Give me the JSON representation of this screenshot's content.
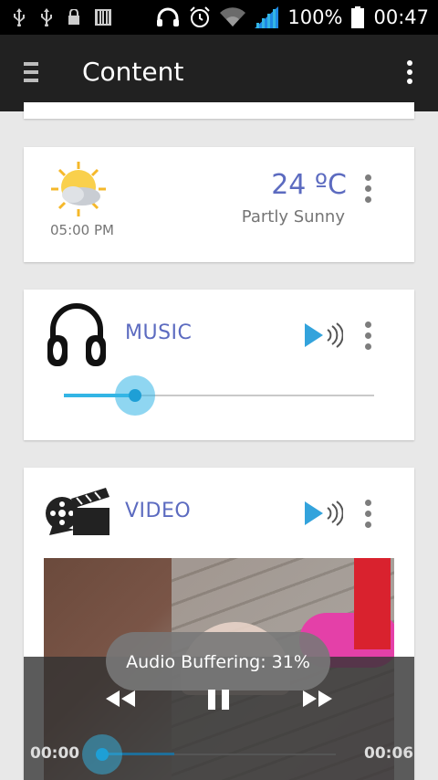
{
  "status_bar": {
    "battery": "100%",
    "time": "00:47",
    "icons": [
      "usb-icon",
      "usb-icon",
      "lock-icon",
      "barcode-icon",
      "headphones-icon",
      "alarm-icon",
      "wifi-icon",
      "signal-icon",
      "battery-icon"
    ]
  },
  "action_bar": {
    "title": "Content",
    "menu_icon": "hamburger-icon",
    "overflow_icon": "more-vert-icon"
  },
  "weather_card": {
    "icon": "partly-sunny-icon",
    "time": "05:00 PM",
    "temperature": "24 ºC",
    "description": "Partly Sunny"
  },
  "music_card": {
    "icon": "headphones-icon",
    "label": "MUSIC",
    "volume_level": 0.23
  },
  "video_card": {
    "icon": "film-clapper-icon",
    "label": "VIDEO"
  },
  "media_controller": {
    "toast": "Audio Buffering: 31%",
    "elapsed": "00:00",
    "duration": "00:06",
    "buffered": 0.31,
    "position": 0.0
  },
  "colors": {
    "accent": "#5c6bc0",
    "slider": "#33b5e5",
    "action_bar": "#212121"
  }
}
